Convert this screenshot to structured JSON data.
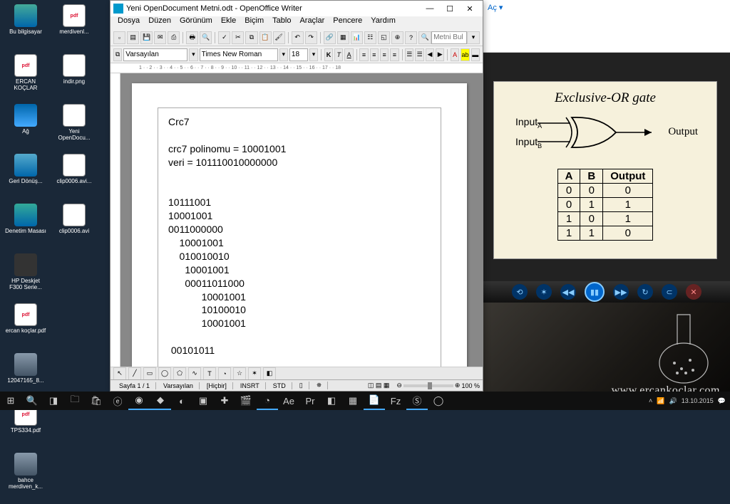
{
  "desktop_icons": [
    {
      "label": "Bu bilgisayar",
      "cls": "pc-ic"
    },
    {
      "label": "merdivenl...",
      "cls": "pdf-ic",
      "g": "pdf"
    },
    {
      "label": "ERCAN KOÇLAR",
      "cls": "pdf-ic",
      "g": "pdf"
    },
    {
      "label": "indir.png",
      "cls": "png-ic"
    },
    {
      "label": "Ağ",
      "cls": "net-ic"
    },
    {
      "label": "Yeni OpenDocu...",
      "cls": "png-ic"
    },
    {
      "label": "Geri Dönüş...",
      "cls": "bin-ic"
    },
    {
      "label": "clip0006.avi...",
      "cls": "png-ic"
    },
    {
      "label": "Denetim Masası",
      "cls": "ctrl-ic"
    },
    {
      "label": "clip0006.avi",
      "cls": "avi-ic"
    },
    {
      "label": "HP Deskjet F300 Serie...",
      "cls": "prn-ic"
    },
    {
      "label": "",
      "cls": ""
    },
    {
      "label": "ercan koçlar.pdf",
      "cls": "pdf-ic",
      "g": "pdf"
    },
    {
      "label": "",
      "cls": ""
    },
    {
      "label": "12047165_8...",
      "cls": "img-ic"
    },
    {
      "label": "",
      "cls": ""
    },
    {
      "label": "TPS334.pdf",
      "cls": "pdf-ic",
      "g": "pdf"
    },
    {
      "label": "",
      "cls": ""
    },
    {
      "label": "bahce merdiven_k...",
      "cls": "img-ic"
    }
  ],
  "writer": {
    "title": "Yeni OpenDocument Metni.odt - OpenOffice Writer",
    "menu": [
      "Dosya",
      "Düzen",
      "Görünüm",
      "Ekle",
      "Biçim",
      "Tablo",
      "Araçlar",
      "Pencere",
      "Yardım"
    ],
    "style": "Varsayılan",
    "font": "Times New Roman",
    "size": "18",
    "find": "Metni Bul",
    "ruler": "1 · · 2 · · 3 · · 4 · · 5 · · 6 · · 7 · · 8 · · 9 · · 10 · · 11 · · 12 · · 13 · · 14 · · 15 · · 16 · · 17 · · 18",
    "doc_lines": [
      "Crc7",
      "",
      "crc7 polinomu = 10001001",
      "veri = 101110010000000",
      "",
      "",
      "10111001",
      "10001001",
      "0011000000",
      "    10001001",
      "    010010010",
      "      10001001",
      "      00011011000",
      "            10001001",
      "            10100010",
      "            10001001",
      "",
      " 00101011"
    ],
    "status": {
      "page": "Sayfa 1 / 1",
      "style": "Varsayılan",
      "lang": "[Hiçbir]",
      "ins": "INSRT",
      "std": "STD",
      "zoom": "100 %"
    }
  },
  "rpane": {
    "open": "Aç ▾",
    "xor_title": "Exclusive-OR gate",
    "inA": "Input",
    "subA": "A",
    "inB": "Input",
    "subB": "B",
    "out": "Output",
    "truth": {
      "head": [
        "A",
        "B",
        "Output"
      ],
      "rows": [
        [
          "0",
          "0",
          "0"
        ],
        [
          "0",
          "1",
          "1"
        ],
        [
          "1",
          "0",
          "1"
        ],
        [
          "1",
          "1",
          "0"
        ]
      ]
    }
  },
  "taskbar": {
    "tray_time": "13.10.2015"
  },
  "watermark": "www.ercankoclar.com"
}
